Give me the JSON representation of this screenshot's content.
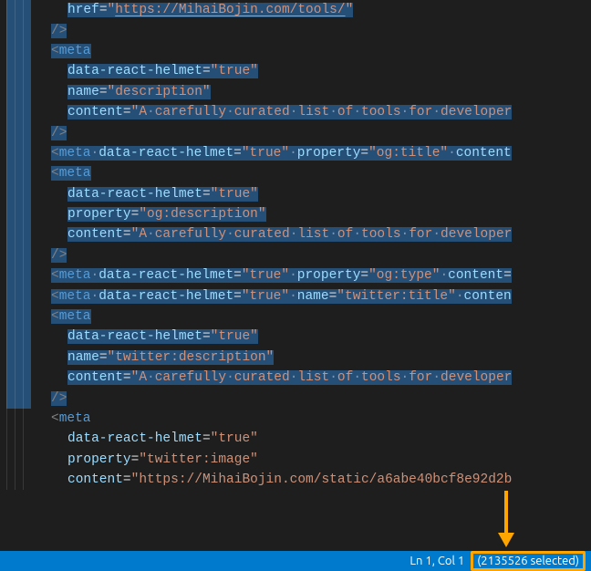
{
  "colors": {
    "selection": "#264f78",
    "statusbar": "#007acc",
    "highlight": "#ffa500"
  },
  "statusbar": {
    "cursor": "Ln 1, Col 1",
    "selection": "(2135526 selected)"
  },
  "annotation": {
    "arrow": "down-arrow pointing to selection count"
  },
  "code": {
    "lines": [
      {
        "indent": 4,
        "selected": true,
        "tokens": [
          [
            "attr",
            "href"
          ],
          [
            "eq",
            "="
          ],
          [
            "str",
            "\""
          ],
          [
            "url",
            "https://MihaiBojin.com/tools/"
          ],
          [
            "str",
            "\""
          ]
        ]
      },
      {
        "indent": 3,
        "selected": true,
        "tokens": [
          [
            "punc",
            "/>"
          ]
        ]
      },
      {
        "indent": 3,
        "selected": true,
        "tokens": [
          [
            "punc",
            "<"
          ],
          [
            "tag",
            "meta"
          ]
        ]
      },
      {
        "indent": 4,
        "selected": true,
        "tokens": [
          [
            "attr",
            "data-react-helmet"
          ],
          [
            "eq",
            "="
          ],
          [
            "str",
            "\"true\""
          ]
        ]
      },
      {
        "indent": 4,
        "selected": true,
        "tokens": [
          [
            "attr",
            "name"
          ],
          [
            "eq",
            "="
          ],
          [
            "str",
            "\"description\""
          ]
        ]
      },
      {
        "indent": 4,
        "selected": true,
        "tokens": [
          [
            "attr",
            "content"
          ],
          [
            "eq",
            "="
          ],
          [
            "str",
            "\"A"
          ],
          [
            "ws",
            "·"
          ],
          [
            "content",
            "carefully"
          ],
          [
            "ws",
            "·"
          ],
          [
            "content",
            "curated"
          ],
          [
            "ws",
            "·"
          ],
          [
            "content",
            "list"
          ],
          [
            "ws",
            "·"
          ],
          [
            "content",
            "of"
          ],
          [
            "ws",
            "·"
          ],
          [
            "content",
            "tools"
          ],
          [
            "ws",
            "·"
          ],
          [
            "content",
            "for"
          ],
          [
            "ws",
            "·"
          ],
          [
            "content",
            "developer"
          ]
        ]
      },
      {
        "indent": 3,
        "selected": true,
        "tokens": [
          [
            "punc",
            "/>"
          ]
        ]
      },
      {
        "indent": 3,
        "selected": true,
        "tokens": [
          [
            "punc",
            "<"
          ],
          [
            "tag",
            "meta"
          ],
          [
            "ws",
            "·"
          ],
          [
            "attr",
            "data-react-helmet"
          ],
          [
            "eq",
            "="
          ],
          [
            "str",
            "\"true\""
          ],
          [
            "ws",
            "·"
          ],
          [
            "attr",
            "property"
          ],
          [
            "eq",
            "="
          ],
          [
            "str",
            "\"og:title\""
          ],
          [
            "ws",
            "·"
          ],
          [
            "attr",
            "content"
          ]
        ]
      },
      {
        "indent": 3,
        "selected": true,
        "tokens": [
          [
            "punc",
            "<"
          ],
          [
            "tag",
            "meta"
          ]
        ]
      },
      {
        "indent": 4,
        "selected": true,
        "tokens": [
          [
            "attr",
            "data-react-helmet"
          ],
          [
            "eq",
            "="
          ],
          [
            "str",
            "\"true\""
          ]
        ]
      },
      {
        "indent": 4,
        "selected": true,
        "tokens": [
          [
            "attr",
            "property"
          ],
          [
            "eq",
            "="
          ],
          [
            "str",
            "\"og:description\""
          ]
        ]
      },
      {
        "indent": 4,
        "selected": true,
        "tokens": [
          [
            "attr",
            "content"
          ],
          [
            "eq",
            "="
          ],
          [
            "str",
            "\"A"
          ],
          [
            "ws",
            "·"
          ],
          [
            "content",
            "carefully"
          ],
          [
            "ws",
            "·"
          ],
          [
            "content",
            "curated"
          ],
          [
            "ws",
            "·"
          ],
          [
            "content",
            "list"
          ],
          [
            "ws",
            "·"
          ],
          [
            "content",
            "of"
          ],
          [
            "ws",
            "·"
          ],
          [
            "content",
            "tools"
          ],
          [
            "ws",
            "·"
          ],
          [
            "content",
            "for"
          ],
          [
            "ws",
            "·"
          ],
          [
            "content",
            "developer"
          ]
        ]
      },
      {
        "indent": 3,
        "selected": true,
        "tokens": [
          [
            "punc",
            "/>"
          ]
        ]
      },
      {
        "indent": 3,
        "selected": true,
        "tokens": [
          [
            "punc",
            "<"
          ],
          [
            "tag",
            "meta"
          ],
          [
            "ws",
            "·"
          ],
          [
            "attr",
            "data-react-helmet"
          ],
          [
            "eq",
            "="
          ],
          [
            "str",
            "\"true\""
          ],
          [
            "ws",
            "·"
          ],
          [
            "attr",
            "property"
          ],
          [
            "eq",
            "="
          ],
          [
            "str",
            "\"og:type\""
          ],
          [
            "ws",
            "·"
          ],
          [
            "attr",
            "content"
          ],
          [
            "eq",
            "="
          ]
        ]
      },
      {
        "indent": 3,
        "selected": true,
        "tokens": [
          [
            "punc",
            "<"
          ],
          [
            "tag",
            "meta"
          ],
          [
            "ws",
            "·"
          ],
          [
            "attr",
            "data-react-helmet"
          ],
          [
            "eq",
            "="
          ],
          [
            "str",
            "\"true\""
          ],
          [
            "ws",
            "·"
          ],
          [
            "attr",
            "name"
          ],
          [
            "eq",
            "="
          ],
          [
            "str",
            "\"twitter:title\""
          ],
          [
            "ws",
            "·"
          ],
          [
            "attr",
            "conten"
          ]
        ]
      },
      {
        "indent": 3,
        "selected": true,
        "tokens": [
          [
            "punc",
            "<"
          ],
          [
            "tag",
            "meta"
          ]
        ]
      },
      {
        "indent": 4,
        "selected": true,
        "tokens": [
          [
            "attr",
            "data-react-helmet"
          ],
          [
            "eq",
            "="
          ],
          [
            "str",
            "\"true\""
          ]
        ]
      },
      {
        "indent": 4,
        "selected": true,
        "tokens": [
          [
            "attr",
            "name"
          ],
          [
            "eq",
            "="
          ],
          [
            "str",
            "\"twitter:description\""
          ]
        ]
      },
      {
        "indent": 4,
        "selected": true,
        "tokens": [
          [
            "attr",
            "content"
          ],
          [
            "eq",
            "="
          ],
          [
            "str",
            "\"A"
          ],
          [
            "ws",
            "·"
          ],
          [
            "content",
            "carefully"
          ],
          [
            "ws",
            "·"
          ],
          [
            "content",
            "curated"
          ],
          [
            "ws",
            "·"
          ],
          [
            "content",
            "list"
          ],
          [
            "ws",
            "·"
          ],
          [
            "content",
            "of"
          ],
          [
            "ws",
            "·"
          ],
          [
            "content",
            "tools"
          ],
          [
            "ws",
            "·"
          ],
          [
            "content",
            "for"
          ],
          [
            "ws",
            "·"
          ],
          [
            "content",
            "developer"
          ]
        ]
      },
      {
        "indent": 3,
        "selected": true,
        "tokens": [
          [
            "punc",
            "/>"
          ]
        ]
      },
      {
        "indent": 3,
        "selected": false,
        "tokens": [
          [
            "punc",
            "<"
          ],
          [
            "tag",
            "meta"
          ]
        ]
      },
      {
        "indent": 4,
        "selected": false,
        "tokens": [
          [
            "attr",
            "data-react-helmet"
          ],
          [
            "eq",
            "="
          ],
          [
            "str",
            "\"true\""
          ]
        ]
      },
      {
        "indent": 4,
        "selected": false,
        "tokens": [
          [
            "attr",
            "property"
          ],
          [
            "eq",
            "="
          ],
          [
            "str",
            "\"twitter:image\""
          ]
        ]
      },
      {
        "indent": 4,
        "selected": false,
        "tokens": [
          [
            "attr",
            "content"
          ],
          [
            "eq",
            "="
          ],
          [
            "str",
            "\"https://MihaiBojin.com/static/a6abe40bcf8e92d2b"
          ]
        ]
      }
    ]
  }
}
